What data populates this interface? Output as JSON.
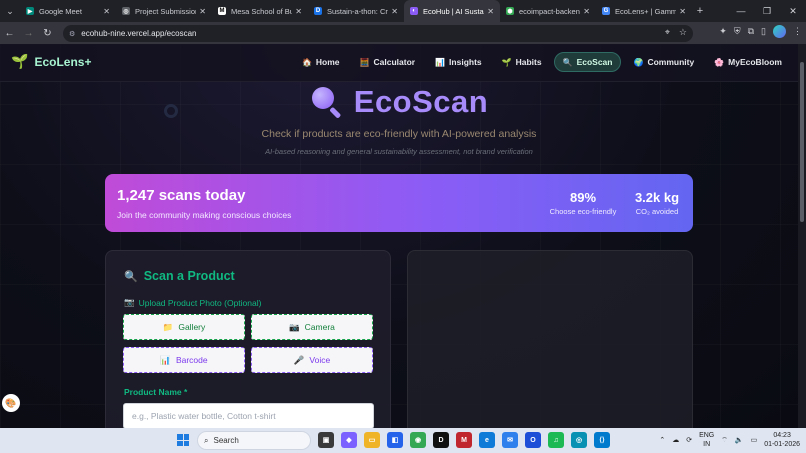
{
  "browser": {
    "tabs": [
      {
        "title": "Google Meet",
        "color": "#00897b",
        "glyph": "▶"
      },
      {
        "title": "Project Submission F",
        "color": "#5f6368",
        "glyph": "◎"
      },
      {
        "title": "Mesa School of Busi",
        "color": "#ffffff",
        "glyph": "M"
      },
      {
        "title": "Sustain-a-thon: Crea",
        "color": "#1a73e8",
        "glyph": "D"
      },
      {
        "title": "EcoHub | AI Sustaina",
        "color": "#8b5cf6",
        "glyph": "◐"
      },
      {
        "title": "ecoimpact-backend",
        "color": "#34a853",
        "glyph": "⬢"
      },
      {
        "title": "EcoLens+ | Gamma",
        "color": "#4285f4",
        "glyph": "G"
      }
    ],
    "active_tab_index": 4,
    "url": "ecohub-nine.vercel.app/ecoscan"
  },
  "app": {
    "brand": "EcoLens+",
    "nav": [
      {
        "label": "Home",
        "icon": "home-icon",
        "glyph": "🏠"
      },
      {
        "label": "Calculator",
        "icon": "calculator-icon",
        "glyph": "🧮"
      },
      {
        "label": "Insights",
        "icon": "chart-icon",
        "glyph": "📊"
      },
      {
        "label": "Habits",
        "icon": "sprout-icon",
        "glyph": "🌱"
      },
      {
        "label": "EcoScan",
        "icon": "magnifier-icon",
        "glyph": "🔍"
      },
      {
        "label": "Community",
        "icon": "globe-icon",
        "glyph": "🌍"
      },
      {
        "label": "MyEcoBloom",
        "icon": "flower-icon",
        "glyph": "🌸"
      }
    ],
    "active_nav": "EcoScan"
  },
  "hero": {
    "title": "EcoScan",
    "subtitle": "Check if products are eco-friendly with AI-powered analysis",
    "note": "AI-based reasoning and general sustainability assessment, not brand verification"
  },
  "stats": {
    "scans": "1,247 scans today",
    "tagline": "Join the community making conscious choices",
    "eco_pct": "89%",
    "eco_pct_label": "Choose eco-friendly",
    "co2": "3.2k kg",
    "co2_label": "CO₂ avoided"
  },
  "scan_form": {
    "heading": "Scan a Product",
    "upload_label": "Upload Product Photo (Optional)",
    "gallery": "Gallery",
    "camera": "Camera",
    "barcode": "Barcode",
    "voice": "Voice",
    "product_name_label": "Product Name *",
    "product_name_placeholder": "e.g., Plastic water bottle, Cotton t-shirt",
    "product_name_value": ""
  },
  "taskbar": {
    "search": "Search",
    "lang_line1": "ENG",
    "lang_line2": "IN",
    "time": "04:23",
    "date": "01-01-2026"
  }
}
